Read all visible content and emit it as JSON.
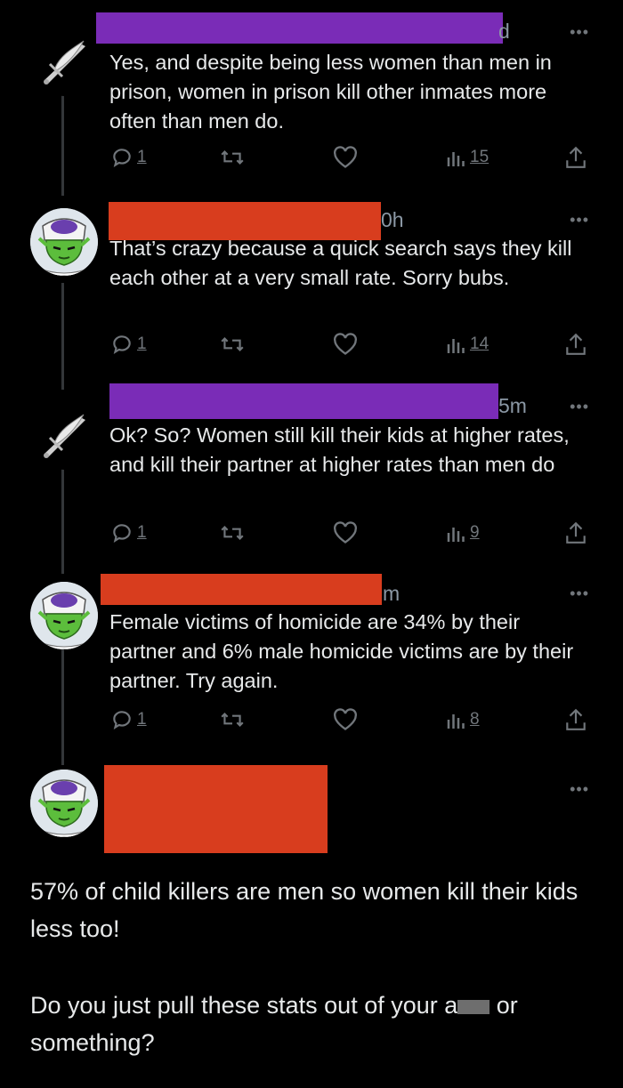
{
  "tweets": [
    {
      "id": 1,
      "time_fragment": "d",
      "text": "Yes, and despite being less women than men in prison, women in prison kill other inmates more often than men do.",
      "replies": "1",
      "views": "15",
      "avatar": "feather-sword-avatar"
    },
    {
      "id": 2,
      "time_fragment": "0h",
      "text": "That’s crazy because a quick search says they kill each other at a very small rate. Sorry bubs.",
      "replies": "1",
      "views": "14",
      "avatar": "green-character-avatar"
    },
    {
      "id": 3,
      "time_fragment": "5m",
      "text": "Ok? So? Women still kill their kids at higher rates, and kill their partner at higher rates than men do",
      "replies": "1",
      "views": "9",
      "avatar": "feather-sword-avatar"
    },
    {
      "id": 4,
      "time_fragment": "m",
      "text": "Female victims of homicide are 34% by their partner and 6% male homicide victims are by their partner. Try again.",
      "replies": "1",
      "views": "8",
      "avatar": "green-character-avatar"
    }
  ],
  "final_post": {
    "paragraph1": "57% of child killers are men so women kill their kids less too!",
    "paragraph2_start": "Do you just pull these stats out of your a",
    "paragraph2_end": " or",
    "paragraph3": "something?"
  },
  "colors": {
    "background": "#000000",
    "redact_purple": "#7a2cb7",
    "redact_red": "#d83d1e",
    "muted": "#71767b"
  },
  "more_glyph": "•••"
}
